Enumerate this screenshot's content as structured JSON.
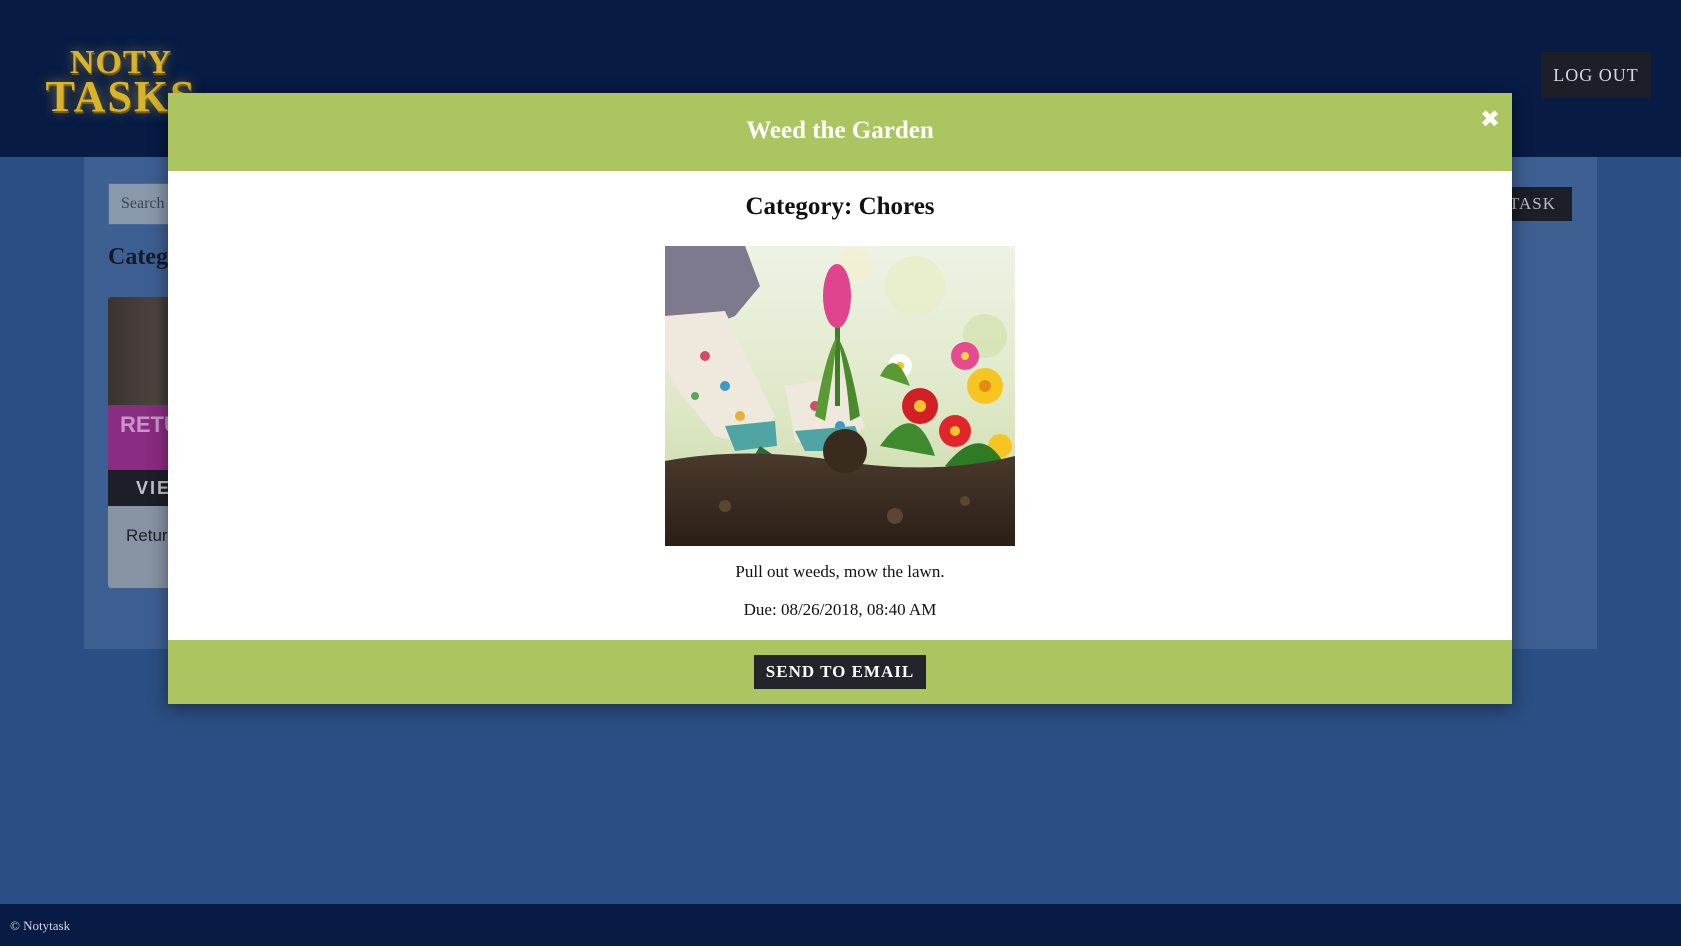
{
  "header": {
    "logo_line1": "NOTY",
    "logo_line2": "TASKS",
    "logout_label": "LOG OUT"
  },
  "toolbar": {
    "search_placeholder": "Search",
    "add_task_label": "ADD TASK"
  },
  "main": {
    "categories_heading": "Categories",
    "card": {
      "banner_text": "RETURN BOOKS",
      "view_label": "VIEW",
      "description": "Return books"
    }
  },
  "modal": {
    "title": "Weed the Garden",
    "close_symbol": "✖",
    "category_text": "Category: Chores",
    "image_alt": "gardening-photo",
    "description": "Pull out weeds, mow the lawn.",
    "due_text": "Due: 08/26/2018, 08:40 AM",
    "send_email_label": "SEND TO EMAIL"
  },
  "footer": {
    "copyright": "© Notytask"
  },
  "colors": {
    "header_bg": "#071b45",
    "page_bg": "#2b4f84",
    "modal_accent": "#adc561",
    "button_dark": "#22252c"
  }
}
